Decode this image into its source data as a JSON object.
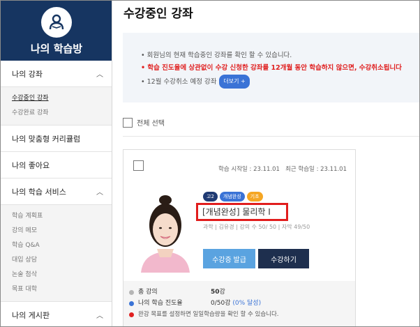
{
  "sidebar": {
    "title": "나의 학습방",
    "sections": [
      {
        "label": "나의 강좌",
        "chevron": "^",
        "subitems": [
          {
            "label": "수강중인 강좌",
            "active": true
          },
          {
            "label": "수강완료 강좌",
            "active": false
          }
        ]
      },
      {
        "label": "나의 맞춤형 커리큘럼"
      },
      {
        "label": "나의 좋아요"
      },
      {
        "label": "나의 학습 서비스",
        "chevron": "^",
        "subitems": [
          {
            "label": "학습 계획표"
          },
          {
            "label": "강의 메모"
          },
          {
            "label": "학습 Q&A"
          },
          {
            "label": "대입 상담"
          },
          {
            "label": "논술 첨삭"
          },
          {
            "label": "목표 대학"
          }
        ]
      },
      {
        "label": "나의 게시판",
        "chevron": "^"
      }
    ]
  },
  "main": {
    "title": "수강중인 강좌",
    "notices": [
      "• 회원님의 현재 학습중인 강좌를 확인 할 수 있습니다.",
      "• 학습 진도율에 상관없이 수강 신청한 강좌를 12개월 동안 학습하지 않으면, 수강취소됩니다",
      "• 12월 수강취소 예정 강좌"
    ],
    "more_label": "더보기 +",
    "select_all": "전체 선택"
  },
  "course": {
    "start_date": "학습 시작일 : 23.11.01",
    "last_date": "최근 학습일 : 23.11.01",
    "badges": [
      {
        "label": "고2",
        "color": "#1f3a73"
      },
      {
        "label": "개념완성",
        "color": "#3a73d6"
      },
      {
        "label": "기초",
        "color": "#f5a623"
      }
    ],
    "title": "[개념완성] 물리학 Ⅰ",
    "meta": "과학 | 김유경 | 강의 수 50/ 50 | 자막 49/50",
    "cert_button": "수강증 발급",
    "study_button": "수강하기",
    "stats": {
      "total_label": "총 강의",
      "total_value": "50",
      "total_unit": "강",
      "progress_label": "나의 학습 진도율",
      "progress_value": "0/50강",
      "progress_pct": "(0% 달성)",
      "note": "완강 목표를 설정하면 일일학습량을 확인 할 수 있습니다."
    }
  }
}
